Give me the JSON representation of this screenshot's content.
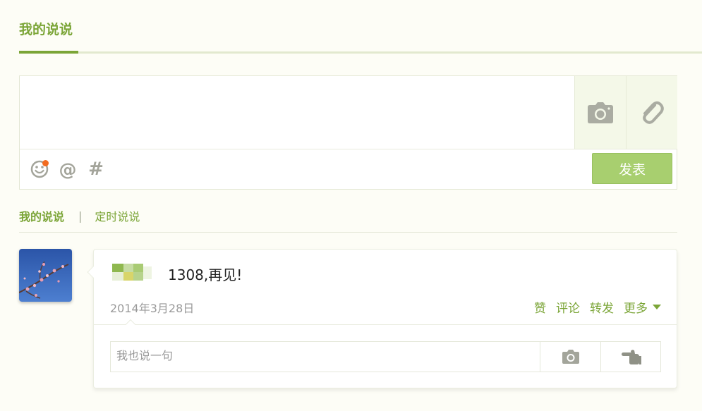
{
  "header": {
    "title": "我的说说"
  },
  "composer": {
    "placeholder": "",
    "tools": {
      "camera_icon": "camera-icon",
      "link_icon": "paperclip-icon"
    },
    "bottom_icons": [
      "smiley-icon",
      "at-icon",
      "hash-icon"
    ],
    "at_glyph": "@",
    "hash_glyph": "#",
    "publish_label": "发表"
  },
  "tabs": {
    "active": "我的说说",
    "separator": "|",
    "other": "定时说说"
  },
  "post": {
    "text": "1308,再见!",
    "date": "2014年3月28日",
    "actions": {
      "like": "赞",
      "comment": "评论",
      "forward": "转发",
      "more": "更多"
    },
    "comment_placeholder": "我也说一句"
  },
  "colors": {
    "accent": "#7ba537",
    "button": "#a8cf6f",
    "notify_dot": "#f26c21",
    "background": "#fdfdf6"
  }
}
